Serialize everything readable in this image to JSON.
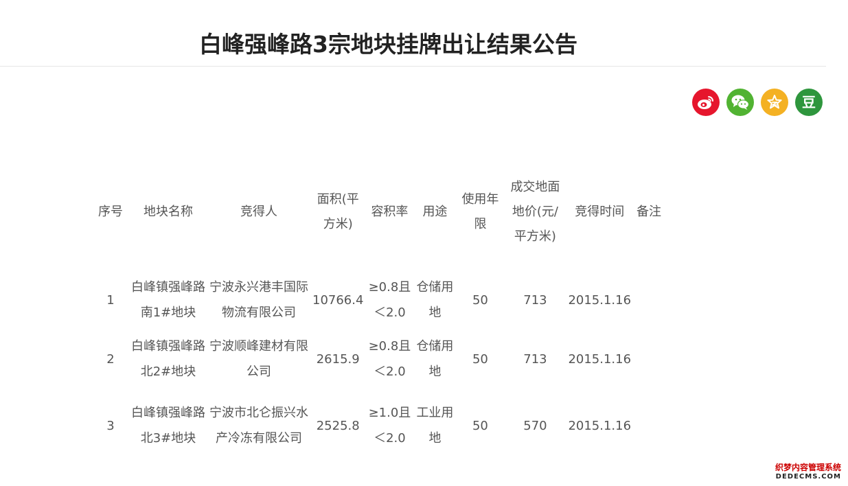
{
  "article": {
    "title": "白峰强峰路3宗地块挂牌出让结果公告"
  },
  "share": {
    "colors": {
      "weibo": "#e6162d",
      "wechat": "#51b332",
      "qzone": "#f4b123",
      "douban": "#2e963d"
    },
    "icons": [
      "weibo-icon",
      "wechat-icon",
      "qzone-icon",
      "douban-icon"
    ],
    "douban_glyph": "豆"
  },
  "table": {
    "headers": {
      "seq": "序号",
      "name": "地块名称",
      "winner": "竞得人",
      "area": "面积(平方米)",
      "far": "容积率",
      "usage": "用途",
      "term": "使用年限",
      "price": "成交地面地价(元/平方米)",
      "time": "竞得时间",
      "remark": "备注"
    },
    "rows": [
      {
        "seq": "1",
        "name": "白峰镇强峰路南1#地块",
        "winner": "宁波永兴港丰国际物流有限公司",
        "area": "10766.4",
        "far": "≥0.8且＜2.0",
        "usage": "仓储用地",
        "term": "50",
        "price": "713",
        "time": "2015.1.16",
        "remark": ""
      },
      {
        "seq": "2",
        "name": "白峰镇强峰路北2#地块",
        "winner": "宁波顺峰建材有限公司",
        "area": "2615.9",
        "far": "≥0.8且＜2.0",
        "usage": "仓储用地",
        "term": "50",
        "price": "713",
        "time": "2015.1.16",
        "remark": ""
      },
      {
        "seq": "3",
        "name": "白峰镇强峰路北3#地块",
        "winner": "宁波市北仑振兴水产冷冻有限公司",
        "area": "2525.8",
        "far": "≥1.0且＜2.0",
        "usage": "工业用地",
        "term": "50",
        "price": "570",
        "time": "2015.1.16",
        "remark": ""
      }
    ]
  },
  "watermark": {
    "cn": "织梦内容管理系统",
    "en": "DEDECMS.COM"
  }
}
